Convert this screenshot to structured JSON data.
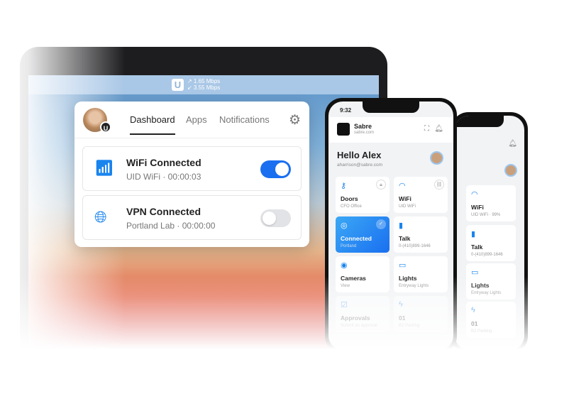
{
  "menubar": {
    "logo": "U",
    "upload": "↗ 1.65 Mbps",
    "download": "↙ 3.55 Mbps"
  },
  "popup": {
    "avatar_badge": "U",
    "tabs": [
      "Dashboard",
      "Apps",
      "Notifications"
    ],
    "cards": [
      {
        "title": "WiFi Connected",
        "subtitle": "UID WiFi · 00:00:03",
        "icon": "wifi-icon",
        "enabled": true
      },
      {
        "title": "VPN Connected",
        "subtitle": "Portland Lab · 00:00:00",
        "icon": "vpn-globe-icon",
        "enabled": false
      }
    ]
  },
  "phone": {
    "time": "9:32",
    "org": "Sabre",
    "domain": "sabre.com",
    "greeting": "Hello Alex",
    "email": "aharrison@sabre.com",
    "tiles": [
      {
        "title": "Doors",
        "sub": "CFO Office",
        "icon": "keys-icon"
      },
      {
        "title": "WiFi",
        "sub": "UID WiFi",
        "icon": "wifi-icon"
      },
      {
        "title": "Connected",
        "sub": "Portland",
        "icon": "vpn-icon"
      },
      {
        "title": "Talk",
        "sub": "0-(410)899-1646",
        "icon": "phone-icon"
      },
      {
        "title": "Cameras",
        "sub": "View",
        "icon": "camera-icon"
      },
      {
        "title": "Lights",
        "sub": "Entryway Lights",
        "icon": "light-icon"
      },
      {
        "title": "Approvals",
        "sub": "Submit an approval",
        "icon": "clipboard-icon"
      },
      {
        "title": "01",
        "sub": "B2 Parking",
        "icon": "bolt-icon"
      }
    ]
  },
  "phone2": {
    "tiles": [
      {
        "title": "WiFi",
        "sub": "UID WiFi · 99%"
      },
      {
        "title": "Talk",
        "sub": "0-(410)899-1646"
      },
      {
        "title": "Lights",
        "sub": "Entryway Lights"
      },
      {
        "title": "01",
        "sub": "B2 Parking"
      }
    ]
  },
  "colors": {
    "accent": "#1a6ff0"
  }
}
